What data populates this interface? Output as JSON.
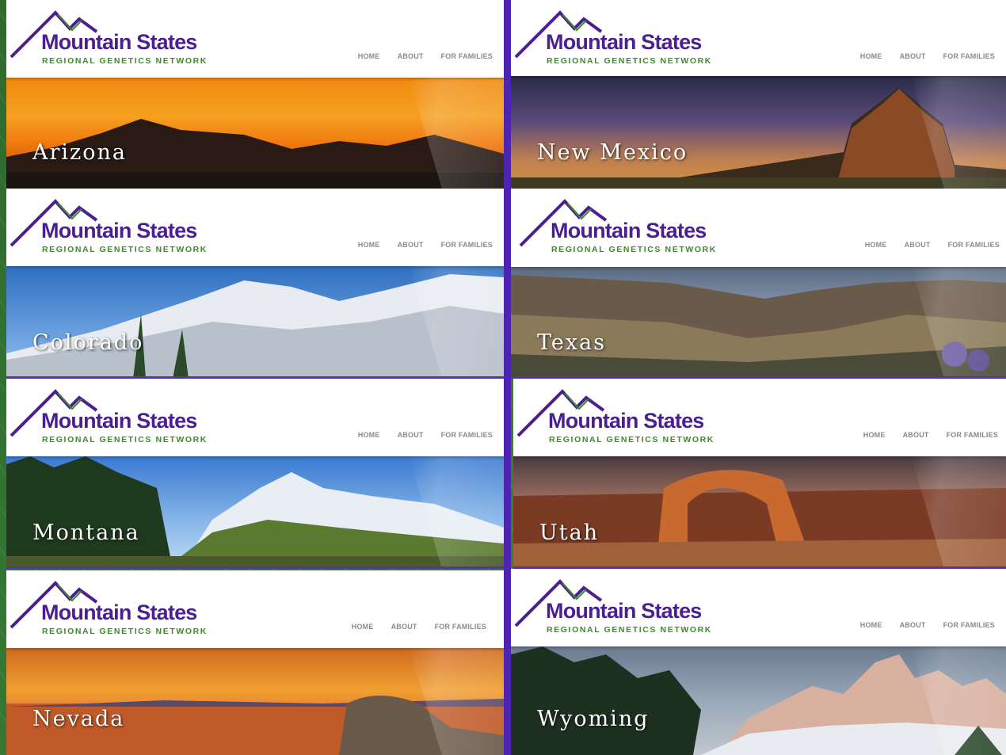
{
  "logo": {
    "title": "Mountain States",
    "subtitle": "REGIONAL GENETICS NETWORK"
  },
  "nav": {
    "home": "HOME",
    "about": "ABOUT",
    "families": "FOR FAMILIES"
  },
  "colors": {
    "brand_purple": "#4b1f8f",
    "brand_green": "#3f8a2b",
    "divider": "#4d24b0"
  },
  "panels": [
    {
      "state": "Arizona"
    },
    {
      "state": "New Mexico"
    },
    {
      "state": "Colorado"
    },
    {
      "state": "Texas"
    },
    {
      "state": "Montana"
    },
    {
      "state": "Utah"
    },
    {
      "state": "Nevada"
    },
    {
      "state": "Wyoming"
    }
  ]
}
